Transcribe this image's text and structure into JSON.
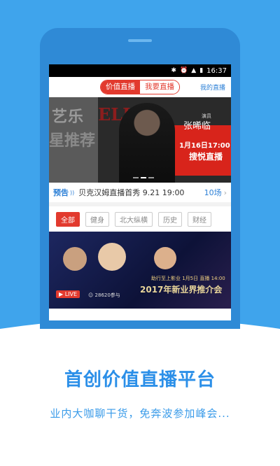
{
  "statusbar": {
    "time": "16:37",
    "bluetooth_icon": "bluetooth-icon",
    "alarm_icon": "alarm-icon",
    "signal_icon": "signal-icon",
    "battery_icon": "battery-icon"
  },
  "topbar": {
    "tab_value_live": "价值直播",
    "tab_want_live": "我要直播",
    "my_live": "我的直播"
  },
  "banner": {
    "left_text_1": "艺乐",
    "left_text_2": "星推荐",
    "brand": "ELL",
    "role": "演员",
    "name": "张晞临",
    "date": "1月16日17:00",
    "live_label": "搜悦直播"
  },
  "notice": {
    "tag": "预告",
    "text": "贝克汉姆直播首秀 9.21 19:00",
    "count": "10场"
  },
  "filters": [
    "全部",
    "健身",
    "北大纵横",
    "历史",
    "财经"
  ],
  "card": {
    "event_title": "2017年新业界推介会",
    "event_sub": "助行至上影业  1月5日 直播 14:00",
    "live_badge": "LIVE",
    "viewers": "28620参与"
  },
  "promo": {
    "headline": "首创价值直播平台",
    "subline": "业内大咖聊干货，免奔波参加峰会..."
  },
  "colors": {
    "brand_blue": "#3fa4ec",
    "accent_red": "#e23a2e",
    "link_blue": "#2b7fd6"
  }
}
